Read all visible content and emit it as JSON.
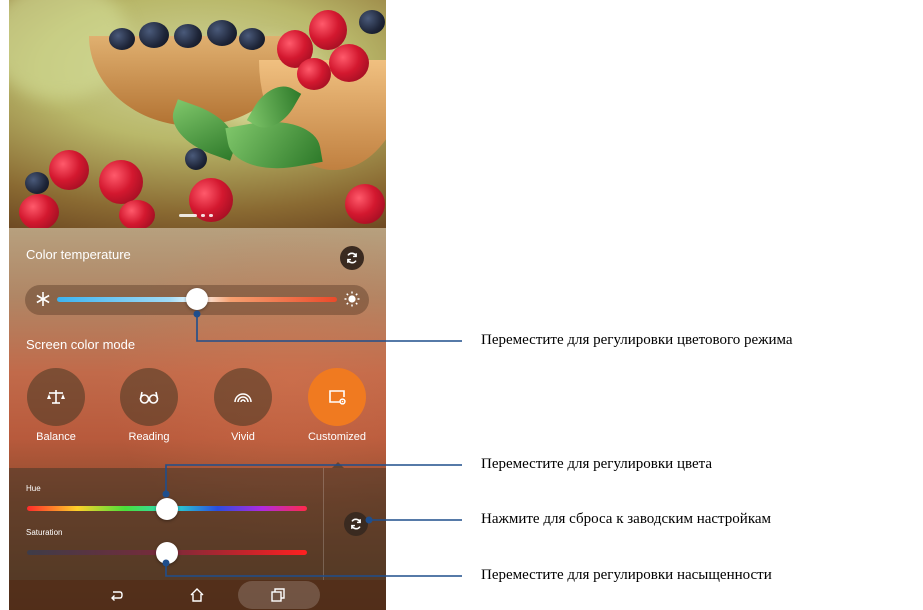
{
  "color_temperature": {
    "title": "Color temperature",
    "cold_icon": "snowflake-icon",
    "warm_icon": "sun-icon",
    "reset_icon": "refresh-icon",
    "value_percent": 50
  },
  "screen_color_mode": {
    "title": "Screen color mode",
    "modes": [
      {
        "label": "Balance",
        "icon": "balance-scale-icon",
        "selected": false
      },
      {
        "label": "Reading",
        "icon": "glasses-icon",
        "selected": false
      },
      {
        "label": "Vivid",
        "icon": "vivid-arcs-icon",
        "selected": false
      },
      {
        "label": "Customized",
        "icon": "customize-screen-icon",
        "selected": true
      }
    ],
    "accent_color": "#f07a20"
  },
  "customized": {
    "hue_label": "Hue",
    "hue_value_percent": 50,
    "saturation_label": "Saturation",
    "saturation_value_percent": 50,
    "reset_icon": "refresh-icon"
  },
  "navbar": {
    "back_icon": "back-icon",
    "home_icon": "home-icon",
    "recents_icon": "recent-apps-icon"
  },
  "callouts": {
    "color_mode": "Переместите для регулировки цветового режима",
    "hue": "Переместите для регулировки цвета",
    "reset": "Нажмите для сброса к заводским настройкам",
    "saturation": "Переместите для регулировки насыщенности"
  }
}
